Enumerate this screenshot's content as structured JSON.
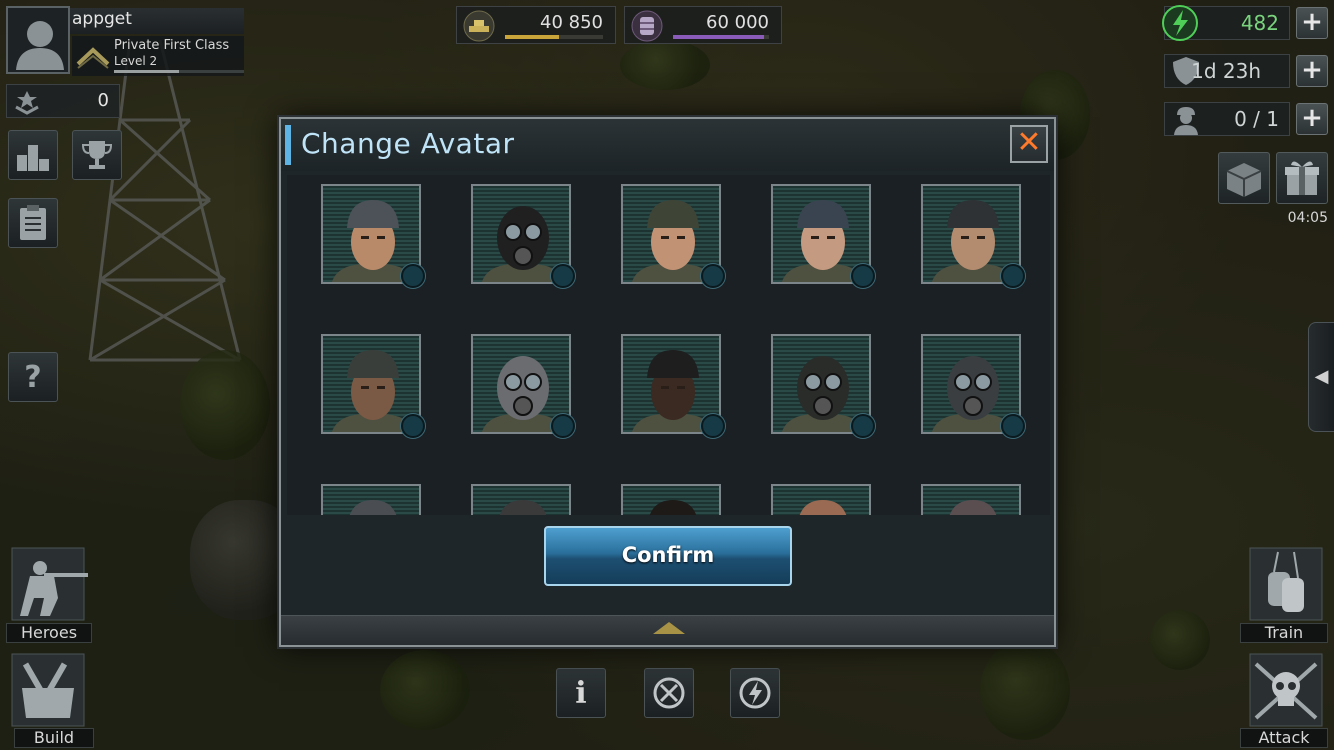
{
  "player": {
    "name": "appget",
    "rank": "Private First Class",
    "level": "Level 2",
    "xp_fraction": 0.5,
    "medals": "0"
  },
  "resources": {
    "gold": "40 850",
    "gold_fill": 0.55,
    "oil": "60 000",
    "oil_fill": 0.95,
    "energy": "482",
    "shield": "1d 23h",
    "builders": "0 / 1"
  },
  "timer": "04:05",
  "modal": {
    "title": "Change Avatar",
    "close_icon": "close-x-icon",
    "confirm_label": "Confirm"
  },
  "avatars": [
    {
      "name": "soldier-beret-tan"
    },
    {
      "name": "gas-mask-hood"
    },
    {
      "name": "soldier-beanie"
    },
    {
      "name": "soldier-beret-dark"
    },
    {
      "name": "soldier-helmet-goggles"
    },
    {
      "name": "soldier-goggles-helmet-2"
    },
    {
      "name": "balaclava"
    },
    {
      "name": "soldier-headset"
    },
    {
      "name": "gas-mask-soldier"
    },
    {
      "name": "gas-mask-helmet"
    },
    {
      "name": "partial-1"
    },
    {
      "name": "partial-2"
    },
    {
      "name": "partial-3"
    },
    {
      "name": "partial-4"
    },
    {
      "name": "partial-5"
    }
  ],
  "bottom_left": {
    "heroes": "Heroes",
    "build": "Build"
  },
  "bottom_right": {
    "train": "Train",
    "attack": "Attack"
  },
  "colors": {
    "accent": "#5fb4e6",
    "title": "#bfe3f7",
    "close": "#ff7a2a",
    "gold_bar": "#c9a53a",
    "oil_bar": "#8a5bb8",
    "energy": "#4fcf58"
  }
}
